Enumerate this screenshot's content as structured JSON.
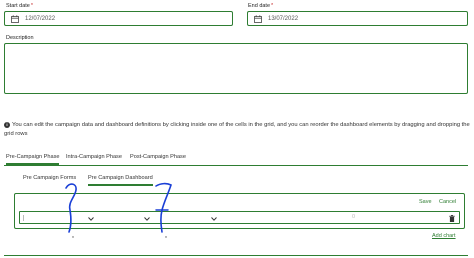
{
  "start_date": {
    "label": "Start date",
    "required_mark": "*",
    "value": "12/07/2022"
  },
  "end_date": {
    "label": "End date",
    "required_mark": "*",
    "value": "13/07/2022"
  },
  "description": {
    "label": "Description",
    "value": ""
  },
  "info_text": "You can edit the campaign data and dashboard definitions by clicking inside one of the cells in the grid, and you can reorder the dashboard elements by dragging and dropping the grid rows",
  "phase_tabs": [
    {
      "label": "Pre-Campaign Phase",
      "active": true
    },
    {
      "label": "Intra-Campaign Phase",
      "active": false
    },
    {
      "label": "Post-Campaign Phase",
      "active": false
    }
  ],
  "sub_tabs": [
    {
      "label": "Pre Campaign Forms",
      "active": false
    },
    {
      "label": "Pre Campaign Dashboard",
      "active": true
    }
  ],
  "row_actions": {
    "save": "Save",
    "cancel": "Cancel"
  },
  "grid_row": {
    "value": "0"
  },
  "add_chart": "Add chart",
  "colors": {
    "accent": "#2e7d32",
    "required": "#c62828",
    "scribble": "#1a3fd6"
  }
}
